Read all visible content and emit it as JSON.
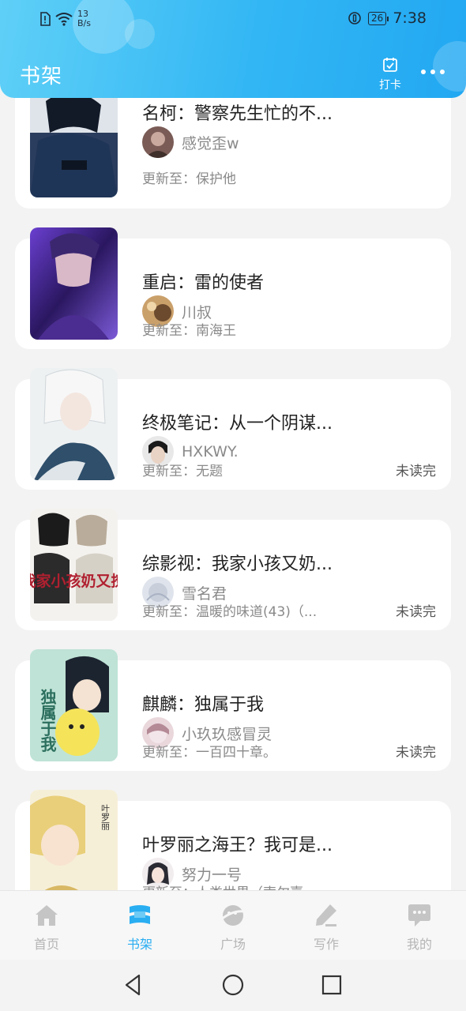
{
  "status_bar": {
    "speed_value": "13",
    "speed_unit": "B/s",
    "battery": "26",
    "time": "7:38"
  },
  "header": {
    "title": "书架",
    "checkin_label": "打卡"
  },
  "books": [
    {
      "title": "名柯：警察先生忙的不...",
      "author": "感觉歪w",
      "update": "更新至：保护他",
      "unread": ""
    },
    {
      "title": "重启：雷的使者",
      "author": "川叔",
      "update": "更新至：南海王",
      "unread": ""
    },
    {
      "title": "终极笔记：从一个阴谋...",
      "author": "HXKWY.",
      "update": "更新至：无题",
      "unread": "未读完"
    },
    {
      "title": "综影视：我家小孩又奶...",
      "author": "雪名君",
      "update": "更新至：温暖的味道(43)（...",
      "unread": "未读完"
    },
    {
      "title": "麒麟：独属于我",
      "author": "小玖玖感冒灵",
      "update": "更新至：一百四十章。",
      "unread": "未读完"
    },
    {
      "title": "叶罗丽之海王？我可是...",
      "author": "努力一号",
      "update": "更新至：人类世界（索尔嘉...",
      "unread": ""
    }
  ],
  "covers": {
    "book4_text": "我家小孩奶又撩",
    "book5_text": "独属于我",
    "book6_text": "叶罗丽"
  },
  "bottom_nav": [
    {
      "label": "首页",
      "icon": "home-icon"
    },
    {
      "label": "书架",
      "icon": "bookshelf-icon"
    },
    {
      "label": "广场",
      "icon": "planet-icon"
    },
    {
      "label": "写作",
      "icon": "pen-icon"
    },
    {
      "label": "我的",
      "icon": "chat-bubble-icon"
    }
  ],
  "colors": {
    "accent": "#2aaef2",
    "header_start": "#5fd0f7",
    "header_end": "#22a8f2",
    "nav_inactive": "#b5b5b5"
  }
}
